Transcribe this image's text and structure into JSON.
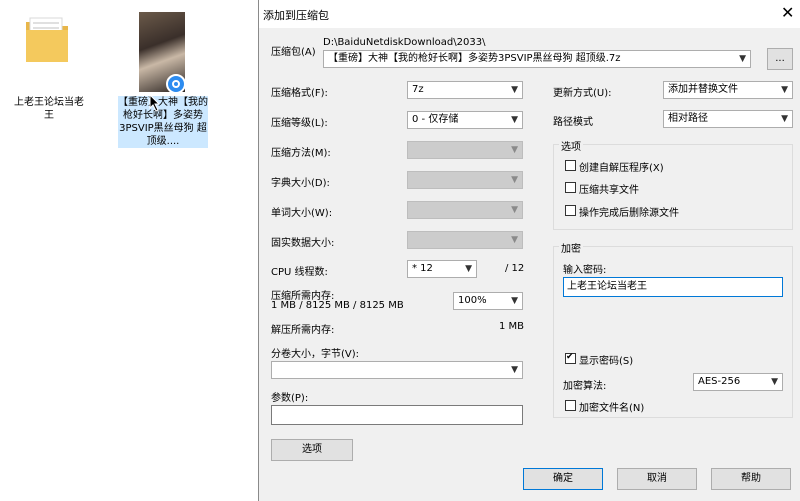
{
  "desktop": {
    "icon1_label": "上老王论坛当老王",
    "icon2_label": "【重磅】大神【我的枪好长啊】多姿势3PSVIP黑丝母狗 超顶级...."
  },
  "dialog": {
    "title": "添加到压缩包",
    "close": "✕",
    "archive_label": "压缩包(A)",
    "archive_path": "D:\\BaiduNetdiskDownload\\2033\\",
    "archive_name": "【重磅】大神【我的枪好长啊】多姿势3PSVIP黑丝母狗 超顶级.7z",
    "browse": "...",
    "format_label": "压缩格式(F):",
    "format_value": "7z",
    "level_label": "压缩等级(L):",
    "level_value": "0 - 仅存储",
    "method_label": "压缩方法(M):",
    "dict_label": "字典大小(D):",
    "word_label": "单词大小(W):",
    "solid_label": "固实数据大小:",
    "cpu_label": "CPU 线程数:",
    "cpu_value": "* 12",
    "cpu_total": "/ 12",
    "mem_comp_label": "压缩所需内存:",
    "mem_comp_value": "1 MB / 8125 MB / 8125 MB",
    "mem_comp_pct": "100%",
    "mem_decomp_label": "解压所需内存:",
    "mem_decomp_value": "1 MB",
    "volume_label": "分卷大小，字节(V):",
    "volume_value": "",
    "params_label": "参数(P):",
    "params_value": "",
    "options_button": "选项",
    "update_label": "更新方式(U):",
    "update_value": "添加并替换文件",
    "pathmode_label": "路径模式",
    "pathmode_value": "相对路径",
    "options_group": "选项",
    "opt_sfx": "创建自解压程序(X)",
    "opt_shared": "压缩共享文件",
    "opt_delete": "操作完成后删除源文件",
    "enc_group": "加密",
    "password_label": "输入密码:",
    "password_value": "上老王论坛当老王",
    "show_password": "显示密码(S)",
    "enc_method_label": "加密算法:",
    "enc_method_value": "AES-256",
    "enc_names": "加密文件名(N)",
    "ok": "确定",
    "cancel": "取消",
    "help": "帮助"
  }
}
